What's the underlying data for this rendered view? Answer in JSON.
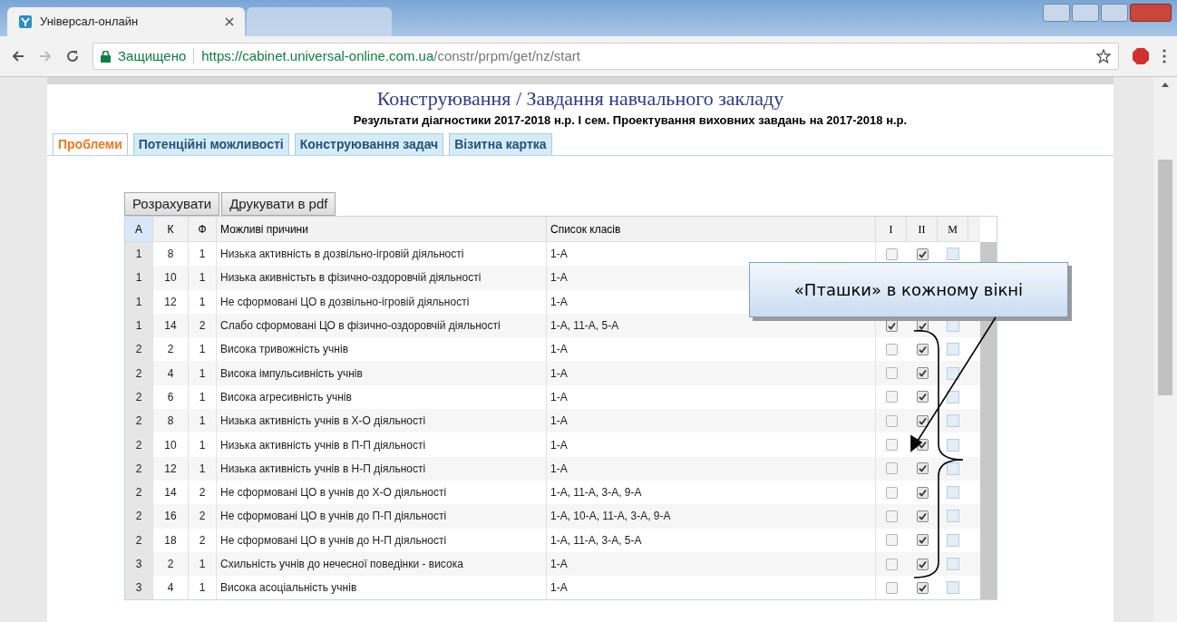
{
  "browser": {
    "tabs": [
      {
        "title": "Універсал-онлайн",
        "selected": true
      },
      {
        "selected": false
      }
    ],
    "address": {
      "secure_label": "Защищено",
      "url_host": "https://cabinet.universal-online.com.ua",
      "url_path": "/constr/prpm/get/nz/start"
    }
  },
  "page": {
    "title": "Конструювання / Завдання навчального закладу",
    "subtitle": "Результати діагностики 2017-2018 н.р. І сем. Проектування виховних завдань на 2017-2018 н.р.",
    "tabs": [
      {
        "label": "Проблеми",
        "selected": true
      },
      {
        "label": "Потенційні можливості",
        "selected": false
      },
      {
        "label": "Конструювання задач",
        "selected": false
      },
      {
        "label": "Візитна картка",
        "selected": false
      }
    ],
    "buttons": [
      "Розрахувати",
      "Друкувати в pdf"
    ],
    "table": {
      "columns": [
        "А",
        "К",
        "Ф",
        "Можливі причини",
        "Список класів",
        "I",
        "II",
        "M"
      ],
      "rows": [
        {
          "a": "1",
          "k": "8",
          "f": "1",
          "reason": "Низька активність в дозвільно-ігровій діяльності",
          "classes": "1-А",
          "i": false,
          "ii": true
        },
        {
          "a": "1",
          "k": "10",
          "f": "1",
          "reason": "Низька акивністьть в фізично-оздоровчій діяльності",
          "classes": "1-А"
        },
        {
          "a": "1",
          "k": "12",
          "f": "1",
          "reason": "Не сформовані ЦО в дозвільно-ігровій діяльності",
          "classes": "1-А"
        },
        {
          "a": "1",
          "k": "14",
          "f": "2",
          "reason": "Слабо сформовані ЦО в фізично-оздоровчій діяльності",
          "classes": "1-А, 11-А, 5-А",
          "i": true,
          "ii": true
        },
        {
          "a": "2",
          "k": "2",
          "f": "1",
          "reason": "Висока тривожність учнів",
          "classes": "1-А",
          "i": false,
          "ii": true
        },
        {
          "a": "2",
          "k": "4",
          "f": "1",
          "reason": "Висока імпульсивність учнів",
          "classes": "1-А",
          "i": false,
          "ii": true
        },
        {
          "a": "2",
          "k": "6",
          "f": "1",
          "reason": "Висока агресивність учнів",
          "classes": "1-А",
          "i": false,
          "ii": true
        },
        {
          "a": "2",
          "k": "8",
          "f": "1",
          "reason": "Низька активність учнів в Х-О діяльності",
          "classes": "1-А",
          "i": false,
          "ii": true
        },
        {
          "a": "2",
          "k": "10",
          "f": "1",
          "reason": "Низька активність учнів в П-П діяльності",
          "classes": "1-А",
          "i": false,
          "ii": true
        },
        {
          "a": "2",
          "k": "12",
          "f": "1",
          "reason": "Низька активність учнів в Н-П діяльності",
          "classes": "1-А",
          "i": false,
          "ii": true
        },
        {
          "a": "2",
          "k": "14",
          "f": "2",
          "reason": "Не сформовані ЦО в учнів до Х-О діяльності",
          "classes": "1-А, 11-А, 3-А, 9-А",
          "i": false,
          "ii": true
        },
        {
          "a": "2",
          "k": "16",
          "f": "2",
          "reason": "Не сформовані ЦО в учнів до П-П діяльності",
          "classes": "1-А, 10-А, 11-А, 3-А, 9-А",
          "i": false,
          "ii": true
        },
        {
          "a": "2",
          "k": "18",
          "f": "2",
          "reason": "Не сформовані ЦО в учнів до Н-П діяльності",
          "classes": "1-А, 11-А, 3-А, 5-А",
          "i": false,
          "ii": true
        },
        {
          "a": "3",
          "k": "2",
          "f": "1",
          "reason": "Схильність учнів до нечесної поведінки - висока",
          "classes": "1-А",
          "i": false,
          "ii": true
        },
        {
          "a": "3",
          "k": "4",
          "f": "1",
          "reason": "Висока асоціальність учнів",
          "classes": "1-А",
          "i": false,
          "ii": true
        }
      ]
    }
  },
  "callout": "«Пташки» в кожному вікні"
}
